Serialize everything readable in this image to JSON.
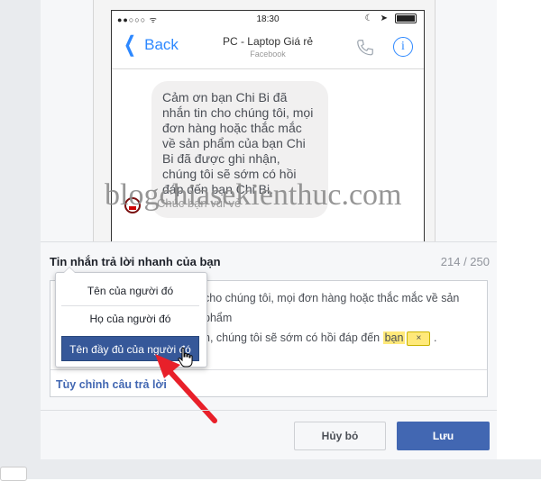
{
  "phone": {
    "time": "18:30",
    "back_label": "Back",
    "chat_title": "PC - Laptop Giá rẻ",
    "chat_subtitle": "Facebook",
    "message": "Cảm ơn bạn Chi Bi đã nhắn tin cho chúng tôi, mọi đơn hàng hoặc thắc mắc về sản phẩm của bạn Chi Bi đã được ghi nhận, chúng tôi sẽ sớm có hồi đáp đến bạn Chi Bi.",
    "sender_line": "Chúc bạn vui vẻ",
    "watermark": "blogchiasekienthuc.com"
  },
  "quick_reply": {
    "title": "Tin nhắn trả lời nhanh của bạn",
    "counter": "214 / 250",
    "text_line1": "cho chúng tôi, mọi đơn hàng hoặc thắc mắc về sản phẩm",
    "text_line2": "n, chúng tôi sẽ sớm có hồi đáp đến",
    "token_word": "bạn",
    "token_remove": "×",
    "text_end": ".",
    "customize_label": "Tùy chỉnh câu trả lời"
  },
  "dropdown": {
    "options": [
      "Tên của người đó",
      "Họ của người đó",
      "Tên đầy đủ của người đó"
    ],
    "selected_index": 2
  },
  "footer": {
    "cancel_label": "Hủy bỏ",
    "save_label": "Lưu"
  },
  "colors": {
    "accent": "#4267b2",
    "selected_option": "#365899",
    "token_highlight": "#ffe97a",
    "arrow": "#e8202a",
    "ios_blue": "#2d88ff"
  }
}
